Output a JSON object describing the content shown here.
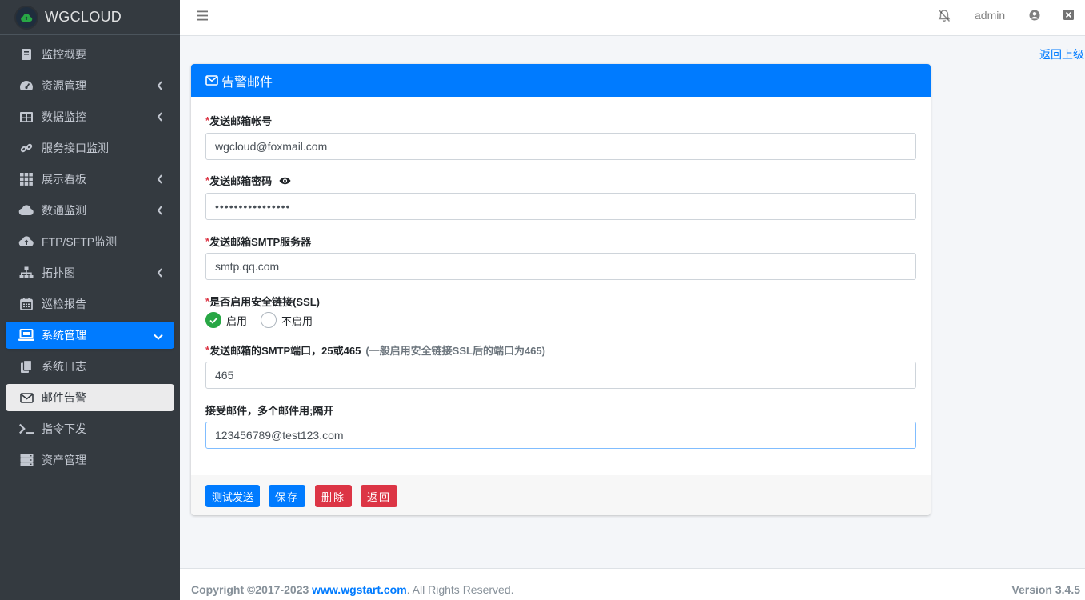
{
  "brand": {
    "name": "WGCLOUD"
  },
  "sidebar": {
    "items": [
      {
        "label": "监控概要",
        "icon": "book-icon",
        "has_children": false
      },
      {
        "label": "资源管理",
        "icon": "tachometer-icon",
        "has_children": true
      },
      {
        "label": "数据监控",
        "icon": "table-icon",
        "has_children": true
      },
      {
        "label": "服务接口监测",
        "icon": "link-icon",
        "has_children": false
      },
      {
        "label": "展示看板",
        "icon": "grid-icon",
        "has_children": true
      },
      {
        "label": "数通监测",
        "icon": "cloud-icon",
        "has_children": true
      },
      {
        "label": "FTP/SFTP监测",
        "icon": "cloud-upload-icon",
        "has_children": false
      },
      {
        "label": "拓扑图",
        "icon": "sitemap-icon",
        "has_children": true
      },
      {
        "label": "巡检报告",
        "icon": "calendar-icon",
        "has_children": false
      },
      {
        "label": "系统管理",
        "icon": "laptop-icon",
        "has_children": true,
        "state": "expanded"
      },
      {
        "label": "系统日志",
        "icon": "copy-icon",
        "has_children": false
      },
      {
        "label": "邮件告警",
        "icon": "envelope-icon",
        "has_children": false,
        "state": "selected"
      },
      {
        "label": "指令下发",
        "icon": "terminal-icon",
        "has_children": false
      },
      {
        "label": "资产管理",
        "icon": "server-icon",
        "has_children": false
      }
    ]
  },
  "topbar": {
    "menu_icon": "hamburger-icon",
    "bell_icon": "bell-slash-icon",
    "user": "admin",
    "user_icon": "user-circle-icon",
    "close_icon": "close-square-icon"
  },
  "page": {
    "back_link": "返回上级"
  },
  "form": {
    "title": "告警邮件",
    "fields": {
      "sender_account": {
        "label": "发送邮箱帐号",
        "value": "wgcloud@foxmail.com"
      },
      "sender_password": {
        "label": "发送邮箱密码",
        "value": "••••••••••••••••"
      },
      "smtp_server": {
        "label": "发送邮箱SMTP服务器",
        "value": "smtp.qq.com"
      },
      "ssl": {
        "label": "是否启用安全链接(SSL)",
        "options": [
          "启用",
          "不启用"
        ],
        "selected": "启用"
      },
      "smtp_port": {
        "label": "发送邮箱的SMTP端口，25或465",
        "hint": "(一般启用安全链接SSL后的端口为465)",
        "value": "465"
      },
      "recipients": {
        "label": "接受邮件，多个邮件用;隔开",
        "value": "123456789@test123.com"
      }
    },
    "buttons": {
      "test": "测试发送",
      "save": "保存",
      "delete": "删除",
      "back": "返回"
    }
  },
  "footer": {
    "copyright": "Copyright ©2017-2023",
    "site": "www.wgstart.com",
    "rights": ". All Rights Reserved.",
    "version": "Version 3.4.5"
  },
  "colors": {
    "primary": "#007bff",
    "danger": "#dc3545",
    "success": "#28a745",
    "sidebar": "#343a40"
  }
}
